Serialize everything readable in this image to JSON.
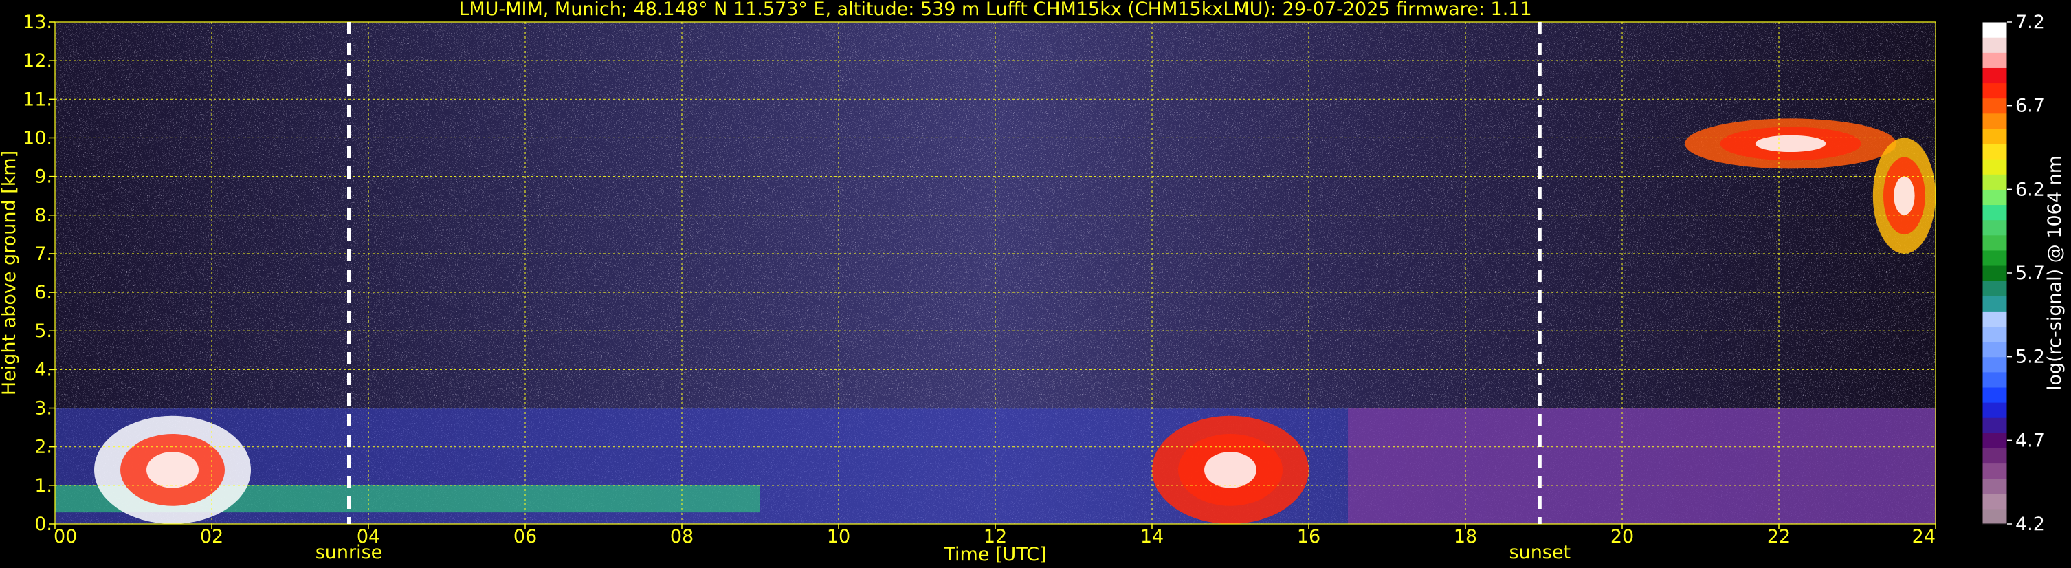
{
  "chart_data": {
    "type": "heatmap",
    "title": "LMU-MIM, Munich; 48.148° N 11.573° E, altitude: 539 m    Lufft CHM15kx (CHM15kxLMU): 29-07-2025    firmware: 1.11",
    "xlabel": "Time [UTC]",
    "ylabel": "Height above ground [km]",
    "xlim": [
      0,
      24
    ],
    "ylim": [
      0,
      13
    ],
    "x_ticks": [
      "00",
      "02",
      "04",
      "06",
      "08",
      "10",
      "12",
      "14",
      "16",
      "18",
      "20",
      "22",
      "24"
    ],
    "y_ticks": [
      "0.",
      "1.",
      "2.",
      "3.",
      "4.",
      "5.",
      "6.",
      "7.",
      "8.",
      "9.",
      "10.",
      "11.",
      "12.",
      "13."
    ],
    "grid": true,
    "markers": [
      {
        "label": "sunrise",
        "x": 3.75
      },
      {
        "label": "sunset",
        "x": 18.95
      }
    ],
    "colorbar": {
      "label": "log(rc-signal) @ 1064 nm",
      "range": [
        4.2,
        7.2
      ],
      "ticks": [
        "4.2",
        "4.7",
        "5.2",
        "5.7",
        "6.2",
        "6.7",
        "7.2"
      ],
      "colors": [
        "#a4889a",
        "#b08aa4",
        "#9a6a96",
        "#8a4a8c",
        "#6e2a7a",
        "#560a6e",
        "#3a1a9a",
        "#1e24d8",
        "#1a44ff",
        "#3a6aff",
        "#5a88ff",
        "#7aa2ff",
        "#96b8ff",
        "#b2ccff",
        "#2a9a9a",
        "#1e8a6a",
        "#0a7a1a",
        "#1aa02a",
        "#3ec04a",
        "#4ad06a",
        "#3ae08a",
        "#7aee6a",
        "#b6f03a",
        "#e8f01a",
        "#ffe01a",
        "#ffb80a",
        "#ff8c0a",
        "#ff5a0a",
        "#ff2a0a",
        "#f0101a",
        "#ffa4a4",
        "#f4d8d8",
        "#ffffff"
      ]
    },
    "features": [
      {
        "desc": "boundary layer / aerosol layer",
        "x": [
          0,
          24
        ],
        "y": [
          0,
          3
        ]
      },
      {
        "desc": "cirrus cloud",
        "x": [
          20.8,
          23.5
        ],
        "y": [
          9.2,
          10.5
        ]
      },
      {
        "desc": "cirrus cloud",
        "x": [
          23.2,
          24
        ],
        "y": [
          7.0,
          10.0
        ]
      },
      {
        "desc": "low clouds",
        "x": [
          0.5,
          2.5
        ],
        "y": [
          0,
          2.8
        ]
      },
      {
        "desc": "low clouds",
        "x": [
          14,
          16
        ],
        "y": [
          0,
          2.8
        ]
      }
    ]
  }
}
